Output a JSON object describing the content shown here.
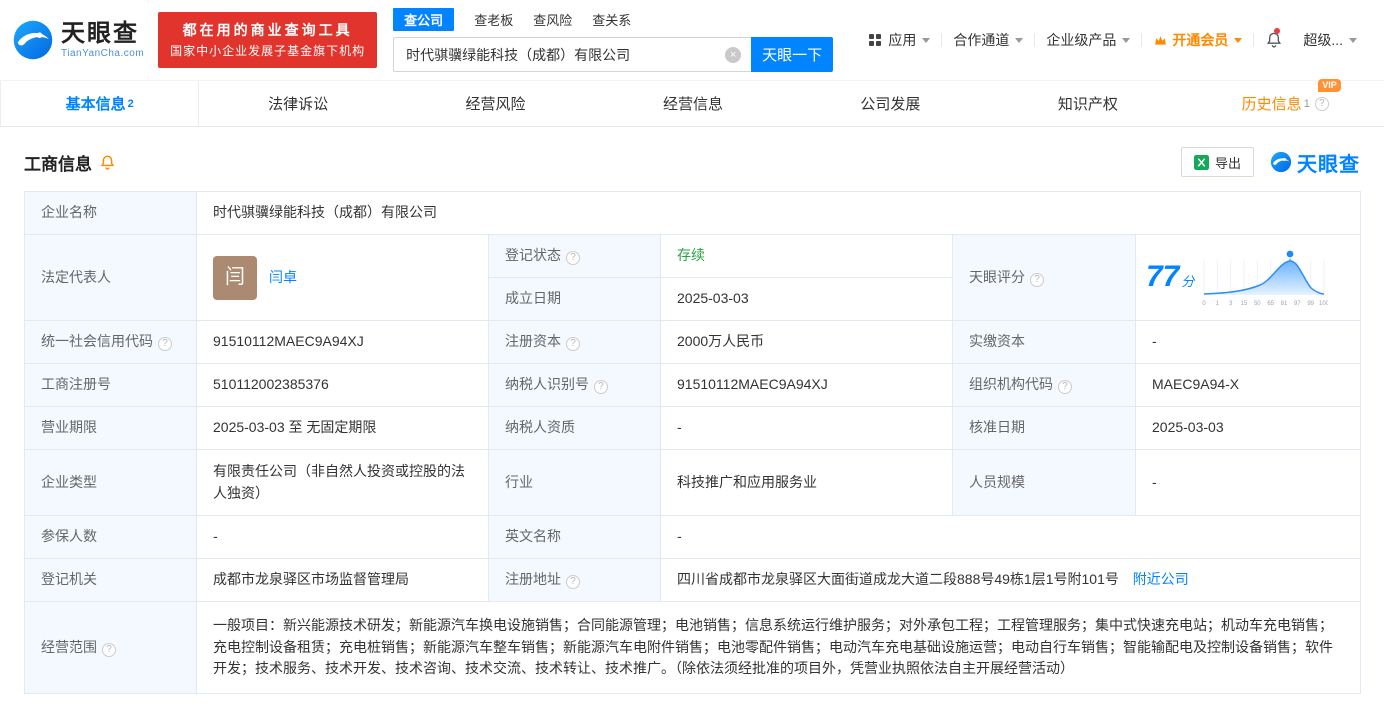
{
  "header": {
    "logo": {
      "title": "天眼查",
      "subtitle": "TianYanCha.com"
    },
    "promo": {
      "line1": "都在用的商业查询工具",
      "line2": "国家中小企业发展子基金旗下机构"
    },
    "search": {
      "tabs": {
        "company": "查公司",
        "boss": "查老板",
        "risk": "查风险",
        "relation": "查关系"
      },
      "value": "时代骐骥绿能科技（成都）有限公司",
      "button": "天眼一下"
    },
    "nav": {
      "apps": "应用",
      "cooperation": "合作通道",
      "enterprise": "企业级产品",
      "vip": "开通会员",
      "user": "超级..."
    }
  },
  "tabs": {
    "basic": {
      "label": "基本信息",
      "count": "2"
    },
    "legal": {
      "label": "法律诉讼"
    },
    "risk": {
      "label": "经营风险"
    },
    "operation": {
      "label": "经营信息"
    },
    "development": {
      "label": "公司发展"
    },
    "ip": {
      "label": "知识产权"
    },
    "history": {
      "label": "历史信息",
      "count": "1",
      "vip": "VIP"
    }
  },
  "section": {
    "title": "工商信息",
    "export_label": "导出",
    "watermark": "天眼查"
  },
  "info": {
    "company_name": {
      "label": "企业名称",
      "value": "时代骐骥绿能科技（成都）有限公司"
    },
    "legal_rep": {
      "label": "法定代表人",
      "value": "闫卓",
      "avatar": "闫"
    },
    "reg_status": {
      "label": "登记状态",
      "value": "存续"
    },
    "establish_date": {
      "label": "成立日期",
      "value": "2025-03-03"
    },
    "score": {
      "label": "天眼评分",
      "value": "77",
      "unit": "分"
    },
    "credit_code": {
      "label": "统一社会信用代码",
      "value": "91510112MAEC9A94XJ"
    },
    "reg_capital": {
      "label": "注册资本",
      "value": "2000万人民币"
    },
    "paid_capital": {
      "label": "实缴资本",
      "value": "-"
    },
    "reg_number": {
      "label": "工商注册号",
      "value": "510112002385376"
    },
    "taxpayer_id": {
      "label": "纳税人识别号",
      "value": "91510112MAEC9A94XJ"
    },
    "org_code": {
      "label": "组织机构代码",
      "value": "MAEC9A94-X"
    },
    "business_term": {
      "label": "营业期限",
      "value": "2025-03-03 至 无固定期限"
    },
    "taxpayer_quality": {
      "label": "纳税人资质",
      "value": "-"
    },
    "approval_date": {
      "label": "核准日期",
      "value": "2025-03-03"
    },
    "company_type": {
      "label": "企业类型",
      "value": "有限责任公司（非自然人投资或控股的法人独资）"
    },
    "industry": {
      "label": "行业",
      "value": "科技推广和应用服务业"
    },
    "staff_size": {
      "label": "人员规模",
      "value": "-"
    },
    "insured_count": {
      "label": "参保人数",
      "value": "-"
    },
    "english_name": {
      "label": "英文名称",
      "value": "-"
    },
    "reg_authority": {
      "label": "登记机关",
      "value": "成都市龙泉驿区市场监督管理局"
    },
    "reg_address": {
      "label": "注册地址",
      "value": "四川省成都市龙泉驿区大面街道成龙大道二段888号49栋1层1号附101号",
      "link": "附近公司"
    },
    "business_scope": {
      "label": "经营范围",
      "value": "一般项目：新兴能源技术研发；新能源汽车换电设施销售；合同能源管理；电池销售；信息系统运行维护服务；对外承包工程；工程管理服务；集中式快速充电站；机动车充电销售；充电控制设备租赁；充电桩销售；新能源汽车整车销售；新能源汽车电附件销售；电池零配件销售；电动汽车充电基础设施运营；电动自行车销售；智能输配电及控制设备销售；软件开发；技术服务、技术开发、技术咨询、技术交流、技术转让、技术推广。（除依法须经批准的项目外，凭营业执照依法自主开展经营活动）"
    }
  },
  "chart_data": {
    "type": "area",
    "title": "天眼评分",
    "score": 77,
    "unit": "分",
    "x_ticks": [
      "0",
      "1",
      "3",
      "15",
      "50",
      "65",
      "81",
      "97",
      "99",
      "100"
    ]
  },
  "icons": {
    "help": "?",
    "clear": "×"
  },
  "colors": {
    "brand_blue": "#0084ff",
    "promo_red": "#e0342c",
    "status_green": "#2ba245",
    "vip_orange": "#ff8a00",
    "excel_green": "#16a85a"
  }
}
